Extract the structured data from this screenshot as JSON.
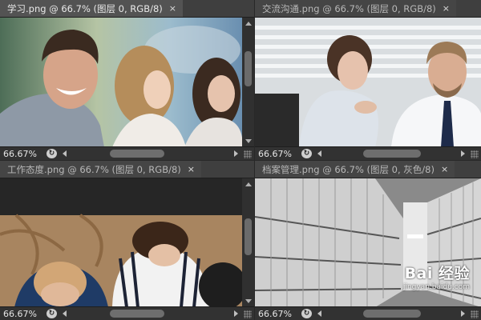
{
  "panels": [
    {
      "tab": "学习.png @ 66.7% (图层 0, RGB/8)",
      "zoom": "66.67%",
      "active": true
    },
    {
      "tab": "交流沟通.png @ 66.7% (图层 0, RGB/8)",
      "zoom": "66.67%",
      "active": false
    },
    {
      "tab": "工作态度.png @ 66.7% (图层 0, RGB/8)",
      "zoom": "66.67%",
      "active": false
    },
    {
      "tab": "档案管理.png @ 66.7% (图层 0, 灰色/8)",
      "zoom": "66.67%",
      "active": false
    }
  ],
  "close_glyph": "×",
  "nav_glyph": "↻",
  "watermark": {
    "main": "Bai 经验",
    "sub": "jingyan.baidu.com"
  }
}
